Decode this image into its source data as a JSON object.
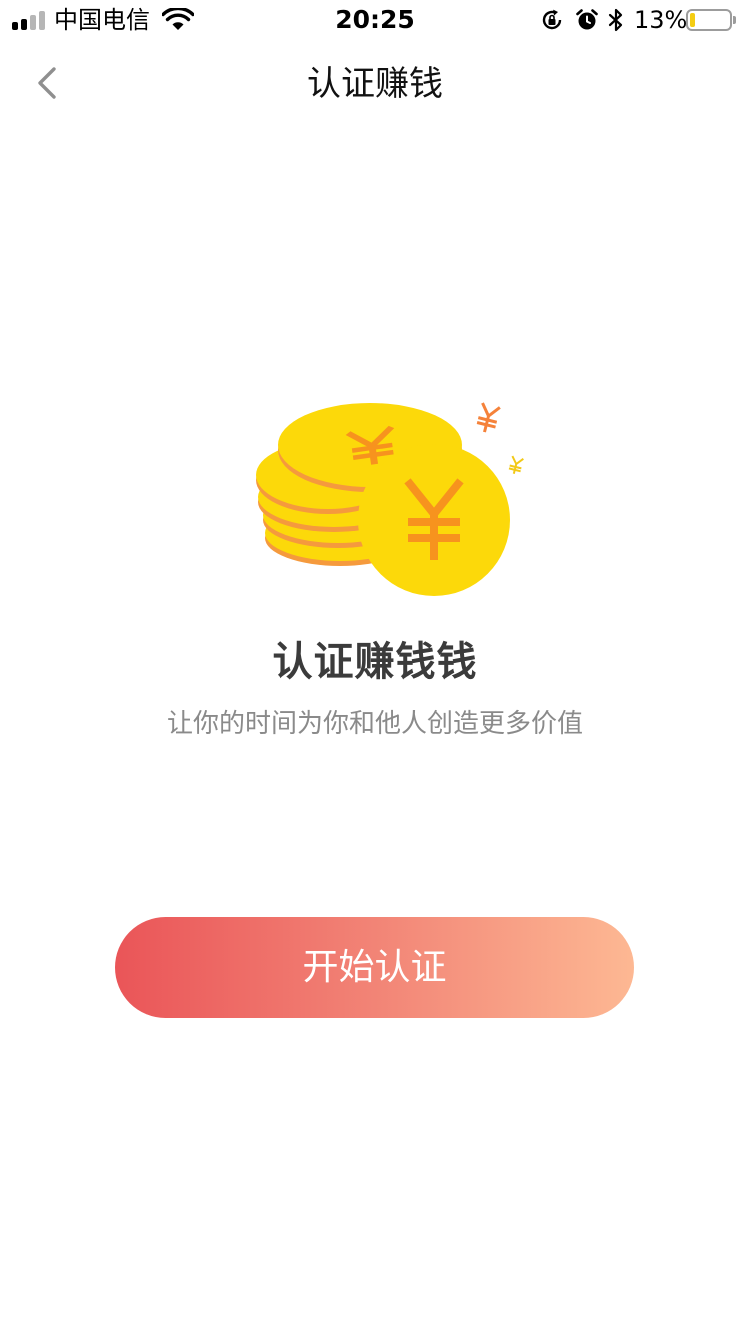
{
  "status_bar": {
    "carrier": "中国电信",
    "time": "20:25",
    "battery_percent": "13%",
    "battery_level": 0.13,
    "icons": [
      "signal-icon",
      "wifi-icon",
      "rotation-lock-icon",
      "alarm-icon",
      "bluetooth-icon",
      "battery-icon"
    ],
    "colors": {
      "battery_fill": "#f4cc12"
    }
  },
  "nav": {
    "title": "认证赚钱",
    "back_icon": "chevron-left-icon"
  },
  "illustration": {
    "icon": "gold-coins-icon",
    "symbol": "¥",
    "colors": {
      "coin": "#fcd90a",
      "symbol": "#f7931e",
      "rim": "#f59a3d"
    }
  },
  "content": {
    "headline": "认证赚钱钱",
    "subline": "让你的时间为你和他人创造更多价值"
  },
  "cta": {
    "label": "开始认证",
    "colors": {
      "gradient_start": "#ea5558",
      "gradient_end": "#fdb893",
      "text": "#ffffff"
    }
  }
}
